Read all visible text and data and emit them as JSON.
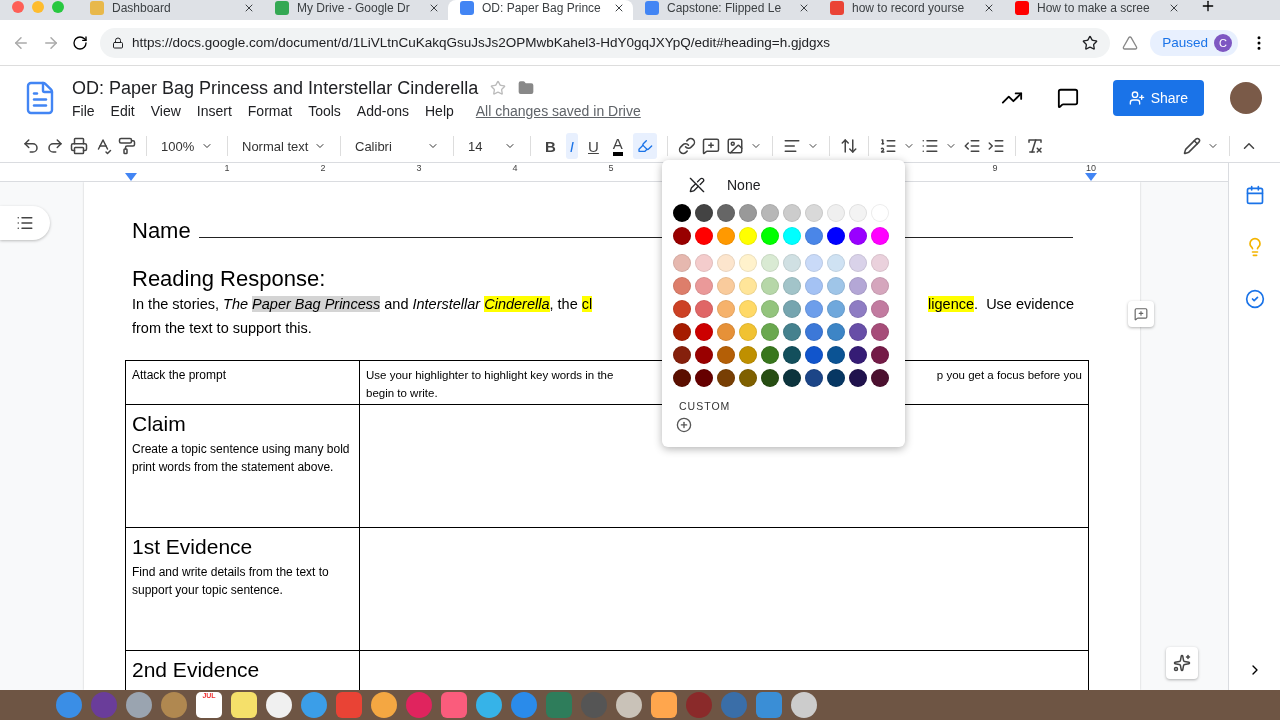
{
  "browser": {
    "tabs": [
      {
        "title": "Dashboard",
        "kind": "canvas",
        "selected": false
      },
      {
        "title": "My Drive - Google Dr",
        "kind": "drive",
        "selected": false
      },
      {
        "title": "OD: Paper Bag Prince",
        "kind": "docs",
        "selected": true
      },
      {
        "title": "Capstone: Flipped Le",
        "kind": "docs",
        "selected": false
      },
      {
        "title": "how to record yourse",
        "kind": "google",
        "selected": false
      },
      {
        "title": "How to make a scree",
        "kind": "youtube",
        "selected": false
      }
    ],
    "url": "https://docs.google.com/document/d/1LiVLtnCuKakqGsuJsJs2OPMwbKahel3-HdY0gqJXYpQ/edit#heading=h.gjdgxs",
    "profile_status": "Paused",
    "profile_initial": "C"
  },
  "docs": {
    "title": "OD: Paper Bag Princess and Interstellar Cinderella",
    "menus": [
      "File",
      "Edit",
      "View",
      "Insert",
      "Format",
      "Tools",
      "Add-ons",
      "Help"
    ],
    "save_status": "All changes saved in Drive",
    "share": "Share"
  },
  "toolbar": {
    "zoom": "100%",
    "style": "Normal text",
    "font": "Calibri",
    "size": "14",
    "format_buttons": [
      {
        "label": "B",
        "kind": "bold",
        "selected": false
      },
      {
        "label": "I",
        "kind": "italic",
        "selected": true
      },
      {
        "label": "U",
        "kind": "underline",
        "selected": false
      },
      {
        "label": "A",
        "kind": "text-color",
        "selected": false
      }
    ],
    "highlight_open": true
  },
  "ruler": [
    "1",
    "2",
    "3",
    "4",
    "5",
    "9",
    "10"
  ],
  "document": {
    "name_label": "Name",
    "heading": "Reading Response:",
    "paragraph": [
      {
        "left": [
          {
            "text": "In the stories, ",
            "italic": false,
            "highlighted": false,
            "selected": false
          },
          {
            "text": "The ",
            "italic": true,
            "highlighted": false,
            "selected": false
          },
          {
            "text": "Paper Bag Princess",
            "italic": true,
            "highlighted": false,
            "selected": true
          },
          {
            "text": " and ",
            "italic": false,
            "highlighted": false,
            "selected": false
          },
          {
            "text": "Interstellar ",
            "italic": true,
            "highlighted": false,
            "selected": false
          },
          {
            "text": "Cinderella",
            "italic": true,
            "highlighted": true,
            "selected": false
          },
          {
            "text": ", the ",
            "italic": false,
            "highlighted": false,
            "selected": false
          },
          {
            "text": "cl",
            "italic": false,
            "highlighted": true,
            "selected": false
          }
        ],
        "right": [
          {
            "text": "ligence",
            "italic": false,
            "highlighted": true,
            "selected": false
          },
          {
            "text": ".  Use evidence",
            "italic": false,
            "highlighted": false,
            "selected": false
          }
        ]
      },
      {
        "left": [
          {
            "text": "from the text to support this.",
            "italic": false,
            "highlighted": false,
            "selected": false
          }
        ]
      }
    ],
    "table": {
      "header": {
        "column_1": "Attack the prompt",
        "column_2_left": "Use your highlighter to highlight key words in the",
        "column_2_right": "p you get a focus before you",
        "column_2_line_2": "begin to write."
      },
      "rows": [
        {
          "heading": "Claim",
          "text": "Create a topic sentence using many bold print words from the statement above."
        },
        {
          "heading": "1st Evidence",
          "text": "Find and write details from the text to support your topic sentence."
        },
        {
          "heading": "2nd Evidence"
        }
      ]
    }
  },
  "highlight_palette": {
    "none_label": "None",
    "rows": [
      {
        "swatches": [
          {
            "color": "#000000"
          },
          {
            "color": "#434343"
          },
          {
            "color": "#666666"
          },
          {
            "color": "#999999"
          },
          {
            "color": "#b7b7b7"
          },
          {
            "color": "#cccccc"
          },
          {
            "color": "#d9d9d9"
          },
          {
            "color": "#efefef"
          },
          {
            "color": "#f3f3f3"
          },
          {
            "color": "#ffffff"
          }
        ]
      },
      {
        "swatches": [
          {
            "color": "#980000"
          },
          {
            "color": "#ff0000"
          },
          {
            "color": "#ff9900"
          },
          {
            "color": "#ffff00"
          },
          {
            "color": "#00ff00"
          },
          {
            "color": "#00ffff"
          },
          {
            "color": "#4a86e8"
          },
          {
            "color": "#0000ff"
          },
          {
            "color": "#9900ff"
          },
          {
            "color": "#ff00ff"
          }
        ]
      },
      {
        "swatches": [
          {
            "color": "#e6b8af"
          },
          {
            "color": "#f4cccc"
          },
          {
            "color": "#fce5cd"
          },
          {
            "color": "#fff2cc"
          },
          {
            "color": "#d9ead3"
          },
          {
            "color": "#d0e0e3"
          },
          {
            "color": "#c9daf8"
          },
          {
            "color": "#cfe2f3"
          },
          {
            "color": "#d9d2e9"
          },
          {
            "color": "#ead1dc"
          }
        ]
      },
      {
        "swatches": [
          {
            "color": "#dd7e6b"
          },
          {
            "color": "#ea9999"
          },
          {
            "color": "#f9cb9c"
          },
          {
            "color": "#ffe599"
          },
          {
            "color": "#b6d7a8"
          },
          {
            "color": "#a2c4c9"
          },
          {
            "color": "#a4c2f4"
          },
          {
            "color": "#9fc5e8"
          },
          {
            "color": "#b4a7d6"
          },
          {
            "color": "#d5a6bd"
          }
        ]
      },
      {
        "swatches": [
          {
            "color": "#cc4125"
          },
          {
            "color": "#e06666"
          },
          {
            "color": "#f6b26b"
          },
          {
            "color": "#ffd966"
          },
          {
            "color": "#93c47d"
          },
          {
            "color": "#76a5af"
          },
          {
            "color": "#6d9eeb"
          },
          {
            "color": "#6fa8dc"
          },
          {
            "color": "#8e7cc3"
          },
          {
            "color": "#c27ba0"
          }
        ]
      },
      {
        "swatches": [
          {
            "color": "#a61c00"
          },
          {
            "color": "#cc0000"
          },
          {
            "color": "#e69138"
          },
          {
            "color": "#f1c232"
          },
          {
            "color": "#6aa84f"
          },
          {
            "color": "#45818e"
          },
          {
            "color": "#3c78d8"
          },
          {
            "color": "#3d85c6"
          },
          {
            "color": "#674ea7"
          },
          {
            "color": "#a64d79"
          }
        ]
      },
      {
        "swatches": [
          {
            "color": "#85200c"
          },
          {
            "color": "#990000"
          },
          {
            "color": "#b45f06"
          },
          {
            "color": "#bf9000"
          },
          {
            "color": "#38761d"
          },
          {
            "color": "#134f5c"
          },
          {
            "color": "#1155cc"
          },
          {
            "color": "#0b5394"
          },
          {
            "color": "#351c75"
          },
          {
            "color": "#741b47"
          }
        ]
      },
      {
        "swatches": [
          {
            "color": "#5b0f00"
          },
          {
            "color": "#660000"
          },
          {
            "color": "#783f04"
          },
          {
            "color": "#7f6000"
          },
          {
            "color": "#274e13"
          },
          {
            "color": "#0c343d"
          },
          {
            "color": "#1c4587"
          },
          {
            "color": "#073763"
          },
          {
            "color": "#20124d"
          },
          {
            "color": "#4c1130"
          }
        ]
      }
    ],
    "custom_label": "CUSTOM"
  },
  "dock": {
    "calendar_month": "JUL"
  }
}
